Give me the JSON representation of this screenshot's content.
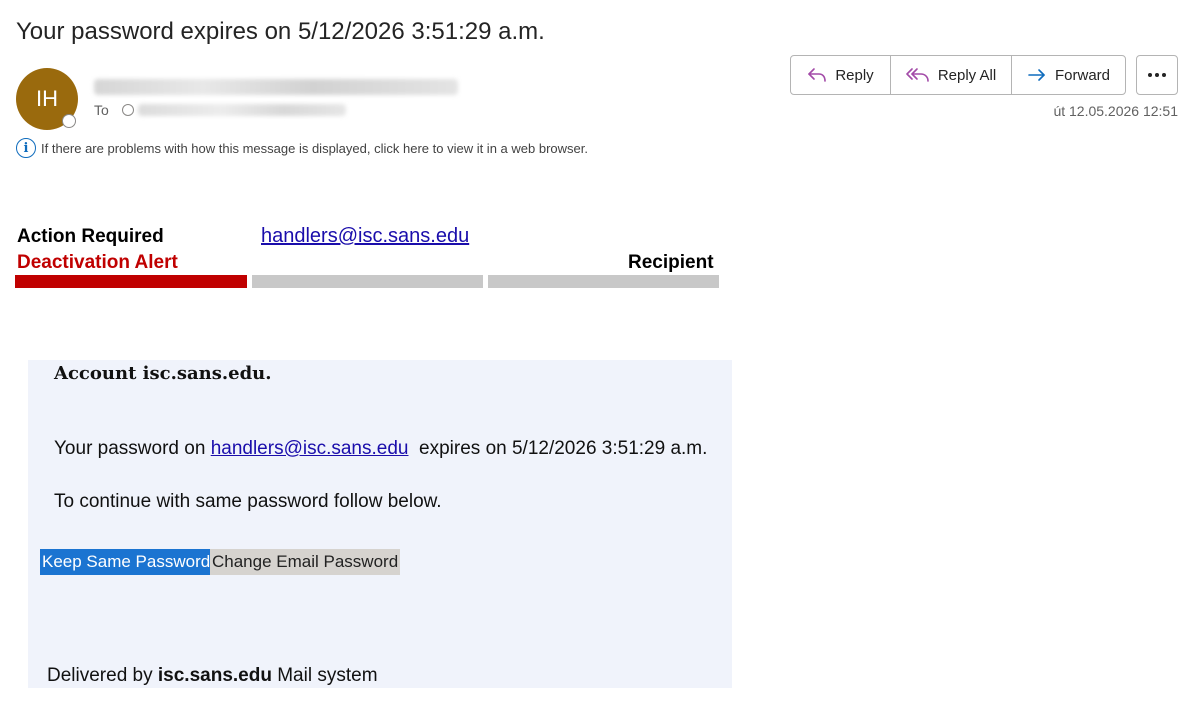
{
  "email": {
    "subject": "Your password expires on 5/12/2026 3:51:29 a.m.",
    "avatar_initials": "IH",
    "to_label": "To",
    "info_message": "If there are problems with how this message is displayed, click here to view it in a web browser.",
    "date": "út 12.05.2026 12:51"
  },
  "toolbar": {
    "reply_label": "Reply",
    "reply_all_label": "Reply All",
    "forward_label": "Forward",
    "reply_icon": "reply-arrow-icon",
    "reply_all_icon": "reply-all-arrow-icon",
    "forward_icon": "forward-arrow-icon",
    "more_icon": "more-horizontal-icon",
    "accent_purple": "#a34ba8",
    "accent_blue": "#0f6cbd"
  },
  "message": {
    "action_required": "Action Required",
    "deactivation_alert": "Deactivation Alert",
    "header_email": "handlers@isc.sans.edu",
    "recipient_label": "Recipient",
    "progress_colors": [
      "#c00000",
      "#c8c8c8",
      "#c8c8c8"
    ],
    "account_heading": "Account isc.sans.edu.",
    "body_prefix": "Your password on ",
    "body_email": "handlers@isc.sans.edu",
    "body_suffix": "  expires on 5/12/2026 3:51:29 a.m.",
    "continue_text": "To continue with same password follow below.",
    "keep_button": "Keep Same Password",
    "change_button": "Change Email Password",
    "delivered_prefix": "Delivered by ",
    "delivered_domain": "isc.sans.edu",
    "delivered_suffix": " Mail system"
  }
}
